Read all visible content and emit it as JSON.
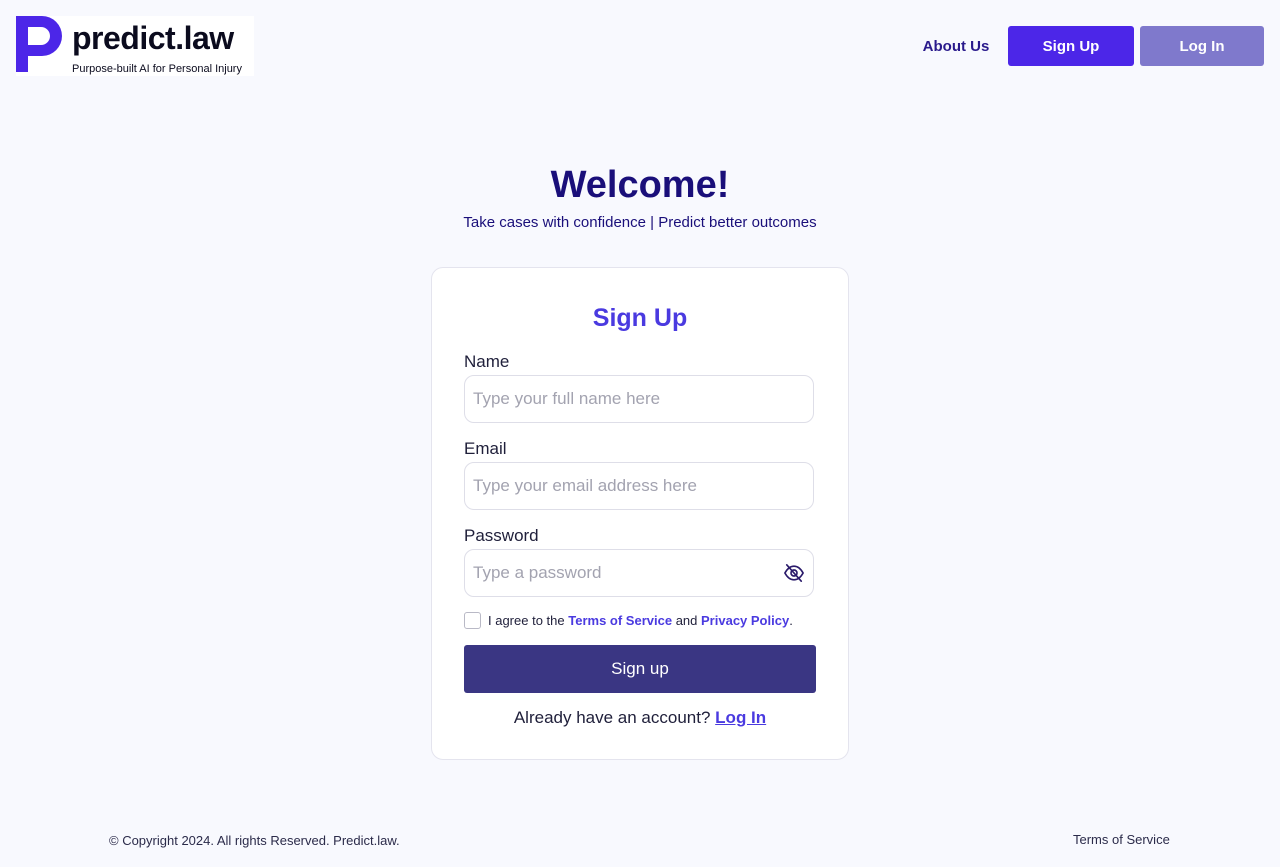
{
  "brand": {
    "name": "predict.law",
    "tagline": "Purpose-built AI for Personal Injury",
    "accent": "#4c26e8"
  },
  "nav": {
    "about": "About Us",
    "signup": "Sign Up",
    "login": "Log In"
  },
  "hero": {
    "title": "Welcome!",
    "subtitle": "Take cases with confidence | Predict better outcomes"
  },
  "form": {
    "title": "Sign Up",
    "name_label": "Name",
    "name_placeholder": "Type your full name here",
    "name_value": "",
    "email_label": "Email",
    "email_placeholder": "Type your email address here",
    "email_value": "",
    "password_label": "Password",
    "password_placeholder": "Type a password",
    "password_value": "",
    "password_toggle_icon": "eye-off-icon",
    "agree_checked": false,
    "agree_prefix": "I agree to the",
    "agree_tos": "Terms of Service",
    "agree_and": "and",
    "agree_privacy": "Privacy Policy",
    "agree_suffix": ".",
    "submit": "Sign up",
    "already_text": "Already have an account?",
    "login_link": "Log In"
  },
  "footer": {
    "copyright": "© Copyright 2024. All rights Reserved. Predict.law.",
    "tos": "Terms of Service"
  }
}
